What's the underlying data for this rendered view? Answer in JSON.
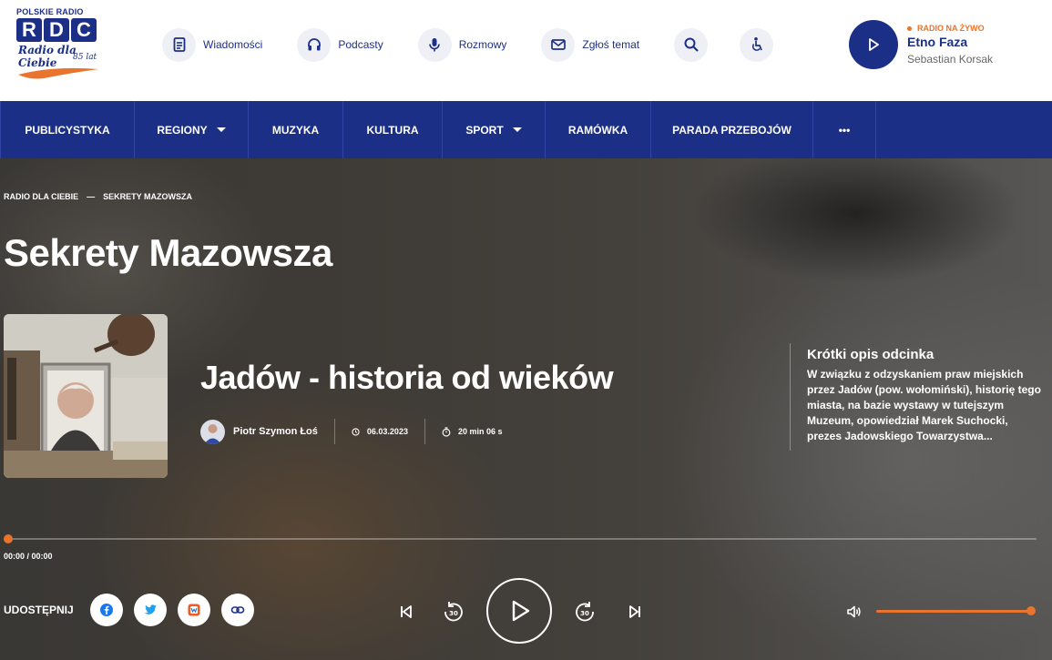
{
  "logo": {
    "top_text": "POLSKIE RADIO",
    "letters": [
      "R",
      "D",
      "C"
    ],
    "script_text": "Radio dla Ciebie",
    "years_text": "85 lat"
  },
  "topnav": {
    "items": [
      {
        "label": "Wiadomości",
        "icon": "document-icon"
      },
      {
        "label": "Podcasty",
        "icon": "headphones-icon"
      },
      {
        "label": "Rozmowy",
        "icon": "microphone-icon"
      },
      {
        "label": "Zgłoś temat",
        "icon": "mail-icon"
      }
    ],
    "search_icon": "search-icon",
    "accessibility_icon": "accessibility-icon"
  },
  "live": {
    "tag": "RADIO NA ŻYWO",
    "station": "Etno Faza",
    "host": "Sebastian Korsak"
  },
  "mainnav": {
    "items": [
      {
        "label": "PUBLICYSTYKA",
        "dropdown": false
      },
      {
        "label": "REGIONY",
        "dropdown": true
      },
      {
        "label": "MUZYKA",
        "dropdown": false
      },
      {
        "label": "KULTURA",
        "dropdown": false
      },
      {
        "label": "SPORT",
        "dropdown": true
      },
      {
        "label": "RAMÓWKA",
        "dropdown": false
      },
      {
        "label": "PARADA PRZEBOJÓW",
        "dropdown": false
      },
      {
        "label": "•••",
        "dropdown": false
      }
    ]
  },
  "breadcrumb": {
    "items": [
      "RADIO DLA CIEBIE",
      "SEKRETY MAZOWSZA"
    ],
    "separator": "—"
  },
  "page_title": "Sekrety Mazowsza",
  "episode": {
    "title": "Jadów - historia od wieków",
    "author": "Piotr Szymon Łoś",
    "date": "06.03.2023",
    "duration": "20 min 06 s"
  },
  "description": {
    "heading": "Krótki opis odcinka",
    "text": "W związku z odzyskaniem praw miejskich przez Jadów (pow. wołomiński), historię tego miasta, na bazie wystawy w tutejszym Muzeum, opowiedział Marek Suchocki, prezes Jadowskiego Towarzystwa..."
  },
  "player": {
    "time": "00:00 / 00:00",
    "progress": 0,
    "volume": 1.0,
    "skip_seconds": "30",
    "share_label": "UDOSTĘPNIJ",
    "share_icons": [
      "facebook-icon",
      "twitter-icon",
      "wykop-icon",
      "link-icon"
    ]
  },
  "colors": {
    "brand_blue": "#1c2f87",
    "accent_orange": "#e8742d"
  }
}
